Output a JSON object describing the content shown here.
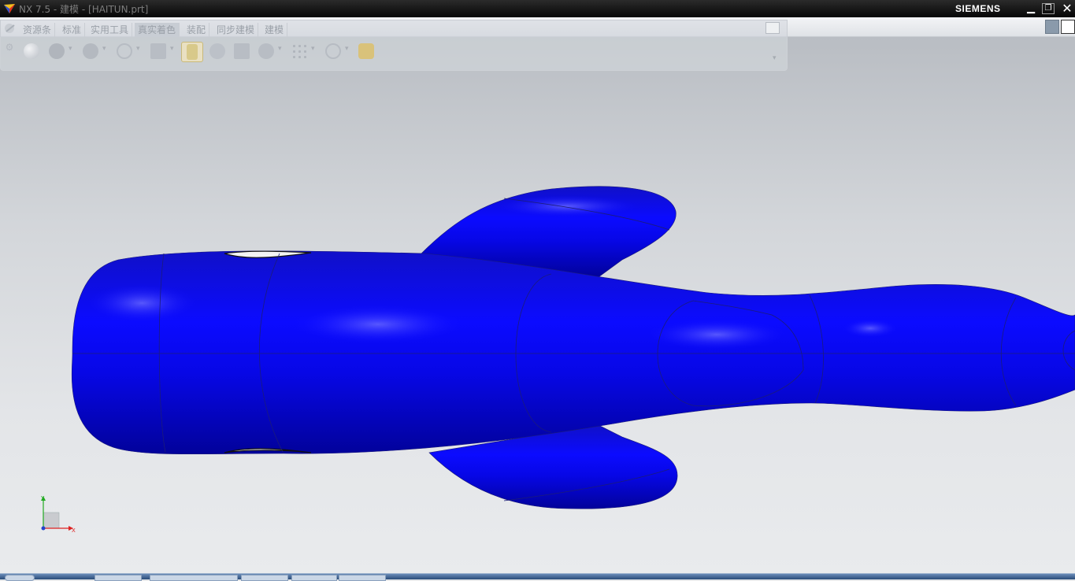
{
  "window": {
    "title": "NX 7.5 - 建模 - [HAITUN.prt]",
    "brand": "SIEMENS",
    "min_glyph": "▁",
    "max_glyph": "❐",
    "close_glyph": "✕"
  },
  "tabs": [
    {
      "label": "资源条"
    },
    {
      "label": "标准"
    },
    {
      "label": "实用工具"
    },
    {
      "label": "真实着色",
      "active": true
    },
    {
      "label": "装配"
    },
    {
      "label": "同步建模"
    },
    {
      "label": "建模"
    }
  ],
  "toolbar": {
    "grip_glyph": "⚙",
    "more_glyph": "▾",
    "tools": [
      {
        "icon": "sphere-shade-icon"
      },
      {
        "icon": "sphere-solid-icon"
      },
      {
        "icon": "sphere-gray-icon"
      },
      {
        "icon": "no-material-icon"
      },
      {
        "icon": "background-swatch-icon"
      },
      {
        "icon": "brush-icon"
      },
      {
        "icon": "user-light-icon"
      },
      {
        "icon": "floor-plane-icon"
      },
      {
        "icon": "user-shadow-icon"
      },
      {
        "icon": "grid-dots-icon"
      },
      {
        "icon": "no-symbol-icon"
      },
      {
        "icon": "wrench-icon"
      }
    ]
  },
  "triad": {
    "y_label": "Y",
    "x_label": "X"
  },
  "colors": {
    "model_fill": "#0b0bf5",
    "model_edge": "#1c1c7a",
    "accent_x": "#d22",
    "accent_y": "#2a2"
  }
}
